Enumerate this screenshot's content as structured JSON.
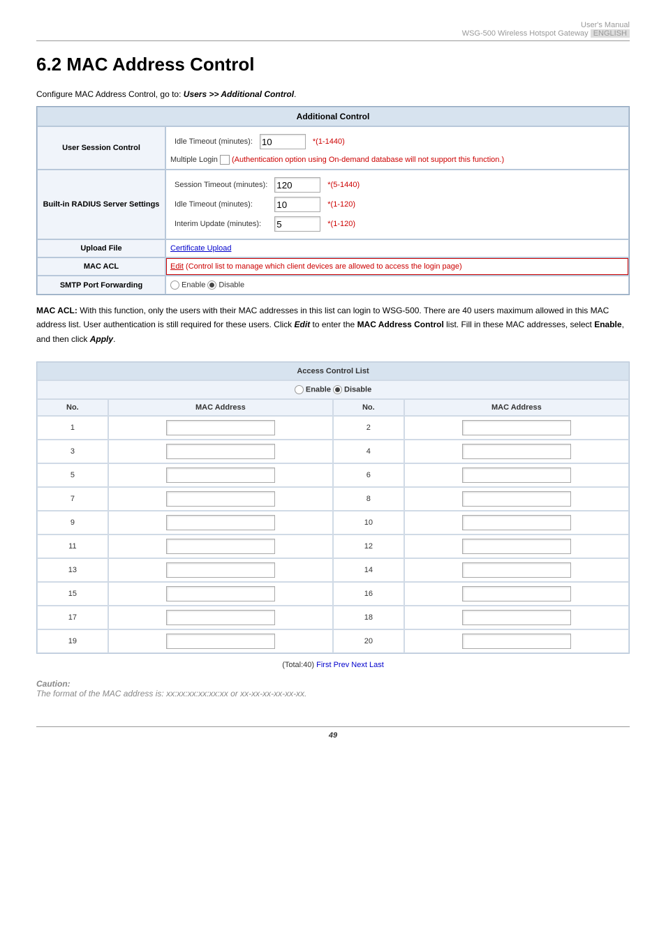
{
  "header": {
    "line1": "User's Manual",
    "line2_a": "WSG-500 Wireless Hotspot Gateway ",
    "line2_b": "ENGLISH"
  },
  "h1": "6.2  MAC Address Control",
  "cfg_pre": "Configure MAC Address Control, go to: ",
  "cfg_bold": "Users >> Additional Control",
  "cfg_post": ".",
  "ac": {
    "title": "Additional Control",
    "row1_label": "User Session Control",
    "row1_idle": "Idle Timeout (minutes):",
    "row1_idle_val": "10",
    "row1_idle_hint": "*(1-1440)",
    "row1_ml": "Multiple Login  ",
    "row1_ml_hint": "(Authentication option using On-demand database will not support this function.)",
    "row2_label": "Built-in RADIUS Server Settings",
    "row2_a": "Session Timeout (minutes):",
    "row2_av": "120",
    "row2_ah": "*(5-1440)",
    "row2_b": "Idle Timeout (minutes):",
    "row2_bv": "10",
    "row2_bh": "*(1-120)",
    "row2_c": "Interim Update (minutes):",
    "row2_cv": "5",
    "row2_ch": "*(1-120)",
    "row3_label": "Upload File",
    "row3_link": "Certificate Upload",
    "row4_label": "MAC ACL",
    "row4_link": "Edit",
    "row4_hint": " (Control list to manage which client devices are allowed to access the login page)",
    "row5_label": "SMTP Port Forwarding",
    "row5_e": " Enable ",
    "row5_d": " Disable"
  },
  "body": {
    "p1a": "MAC ACL: ",
    "p1b": "With this function, only the users with their MAC addresses in this list can login to WSG-500. There are 40 users maximum allowed in this MAC address list. User authentication is still required for these users. Click ",
    "p1c": "Edit",
    "p1d": " to enter the ",
    "p1e": "MAC Address Control",
    "p1f": " list. Fill in these MAC addresses, select ",
    "p1g": "Enable",
    "p1h": ", and then click ",
    "p1i": "Apply",
    "p1j": "."
  },
  "acl": {
    "title": "Access Control List",
    "enable": " Enable ",
    "disable": " Disable",
    "col_no": "No.",
    "col_mac": "MAC Address",
    "rows": [
      [
        1,
        2
      ],
      [
        3,
        4
      ],
      [
        5,
        6
      ],
      [
        7,
        8
      ],
      [
        9,
        10
      ],
      [
        11,
        12
      ],
      [
        13,
        14
      ],
      [
        15,
        16
      ],
      [
        17,
        18
      ],
      [
        19,
        20
      ]
    ]
  },
  "pager": {
    "total": "(Total:40) ",
    "first": "First",
    "prev": "Prev",
    "next": "Next",
    "last": "Last"
  },
  "caution": {
    "h": "Caution:",
    "t": "The format of the MAC address is: xx:xx:xx:xx:xx:xx or xx-xx-xx-xx-xx-xx."
  },
  "page_no": "49"
}
